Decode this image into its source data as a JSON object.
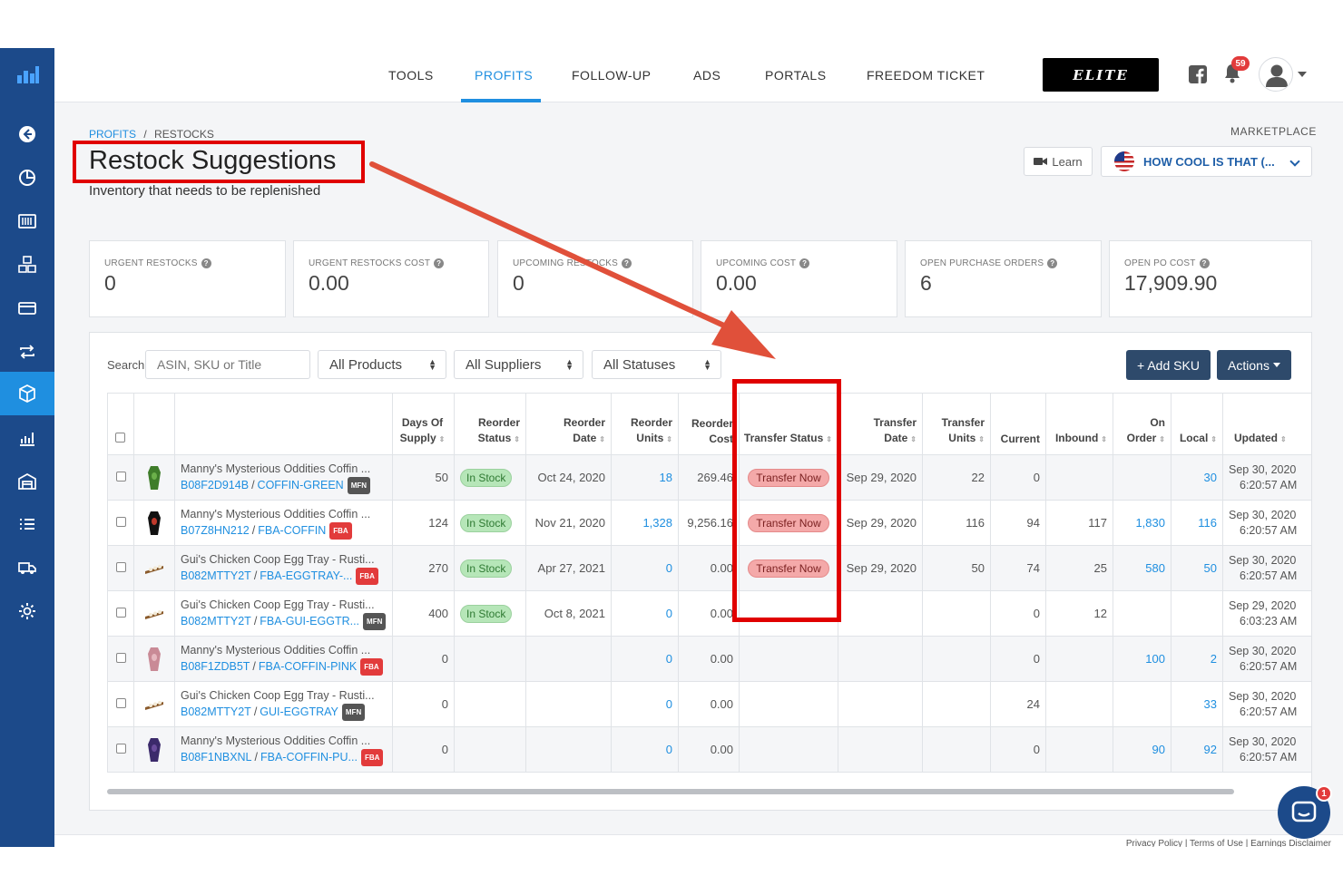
{
  "nav": {
    "items": [
      "TOOLS",
      "PROFITS",
      "FOLLOW-UP",
      "ADS",
      "PORTALS",
      "FREEDOM TICKET"
    ],
    "active": "PROFITS",
    "elite_label": "ELITE",
    "notifications": "59"
  },
  "sidebar": {
    "icons": [
      "back-arrow-icon",
      "pie-chart-icon",
      "barcode-icon",
      "boxes-icon",
      "credit-card-icon",
      "repeat-icon",
      "cube-icon",
      "bar-chart-icon",
      "warehouse-icon",
      "list-icon",
      "truck-icon",
      "settings-gear-icon"
    ],
    "active": "cube-icon"
  },
  "breadcrumb": {
    "root": "PROFITS",
    "separator": "/",
    "current": "RESTOCKS"
  },
  "page": {
    "title": "Restock Suggestions",
    "subtitle": "Inventory that needs to be replenished"
  },
  "marketplace": {
    "label": "MARKETPLACE",
    "learn": "Learn",
    "store": "HOW COOL IS THAT (..."
  },
  "cards": [
    {
      "label": "URGENT RESTOCKS",
      "value": "0"
    },
    {
      "label": "URGENT RESTOCKS COST",
      "value": "0.00"
    },
    {
      "label": "UPCOMING RESTOCKS",
      "value": "0"
    },
    {
      "label": "UPCOMING COST",
      "value": "0.00"
    },
    {
      "label": "OPEN PURCHASE ORDERS",
      "value": "6"
    },
    {
      "label": "OPEN PO COST",
      "value": "17,909.90"
    }
  ],
  "filters": {
    "search_label": "Search",
    "search_placeholder": "ASIN, SKU or Title",
    "products": "All Products",
    "suppliers": "All Suppliers",
    "statuses": "All Statuses",
    "add_sku": "+ Add SKU",
    "actions": "Actions"
  },
  "table": {
    "headers": {
      "days": "Days Of Supply",
      "reorder_status": "Reorder Status",
      "reorder_date": "Reorder Date",
      "reorder_units": "Reorder Units",
      "reorder_cost": "Reorder Cost",
      "transfer_status": "Transfer Status",
      "transfer_date": "Transfer Date",
      "transfer_units": "Transfer Units",
      "current": "Current",
      "inbound": "Inbound",
      "on_order": "On Order",
      "local": "Local",
      "updated": "Updated"
    },
    "rows": [
      {
        "thumb": "green",
        "name": "Manny's Mysterious Oddities Coffin ...",
        "asin": "B08F2D914B",
        "sku": "COFFIN-GREEN",
        "channel": "MFN",
        "days": "50",
        "reorder_status": "In Stock",
        "reorder_date": "Oct 24, 2020",
        "reorder_units": "18",
        "reorder_cost": "269.46",
        "transfer_status": "Transfer Now",
        "transfer_date": "Sep 29, 2020",
        "transfer_units": "22",
        "current": "0",
        "inbound": "",
        "on_order": "",
        "local": "30",
        "updated_date": "Sep 30, 2020",
        "updated_time": "6:20:57 AM"
      },
      {
        "thumb": "black",
        "name": "Manny's Mysterious Oddities Coffin ...",
        "asin": "B07Z8HN212",
        "sku": "FBA-COFFIN",
        "channel": "FBA",
        "days": "124",
        "reorder_status": "In Stock",
        "reorder_date": "Nov 21, 2020",
        "reorder_units": "1,328",
        "reorder_cost": "9,256.16",
        "transfer_status": "Transfer Now",
        "transfer_date": "Sep 29, 2020",
        "transfer_units": "116",
        "current": "94",
        "inbound": "117",
        "on_order": "1,830",
        "local": "116",
        "updated_date": "Sep 30, 2020",
        "updated_time": "6:20:57 AM"
      },
      {
        "thumb": "tray",
        "name": "Gui's Chicken Coop Egg Tray - Rusti...",
        "asin": "B082MTTY2T",
        "sku": "FBA-EGGTRAY-...",
        "channel": "FBA",
        "days": "270",
        "reorder_status": "In Stock",
        "reorder_date": "Apr 27, 2021",
        "reorder_units": "0",
        "reorder_cost": "0.00",
        "transfer_status": "Transfer Now",
        "transfer_date": "Sep 29, 2020",
        "transfer_units": "50",
        "current": "74",
        "inbound": "25",
        "on_order": "580",
        "local": "50",
        "updated_date": "Sep 30, 2020",
        "updated_time": "6:20:57 AM"
      },
      {
        "thumb": "tray",
        "name": "Gui's Chicken Coop Egg Tray - Rusti...",
        "asin": "B082MTTY2T",
        "sku": "FBA-GUI-EGGTR...",
        "channel": "MFN",
        "days": "400",
        "reorder_status": "In Stock",
        "reorder_date": "Oct 8, 2021",
        "reorder_units": "0",
        "reorder_cost": "0.00",
        "transfer_status": "",
        "transfer_date": "",
        "transfer_units": "",
        "current": "0",
        "inbound": "12",
        "on_order": "",
        "local": "",
        "updated_date": "Sep 29, 2020",
        "updated_time": "6:03:23 AM"
      },
      {
        "thumb": "pink",
        "name": "Manny's Mysterious Oddities Coffin ...",
        "asin": "B08F1ZDB5T",
        "sku": "FBA-COFFIN-PINK",
        "channel": "FBA",
        "days": "0",
        "reorder_status": "",
        "reorder_date": "",
        "reorder_units": "0",
        "reorder_cost": "0.00",
        "transfer_status": "",
        "transfer_date": "",
        "transfer_units": "",
        "current": "0",
        "inbound": "",
        "on_order": "100",
        "local": "2",
        "updated_date": "Sep 30, 2020",
        "updated_time": "6:20:57 AM"
      },
      {
        "thumb": "tray",
        "name": "Gui's Chicken Coop Egg Tray - Rusti...",
        "asin": "B082MTTY2T",
        "sku": "GUI-EGGTRAY",
        "channel": "MFN",
        "days": "0",
        "reorder_status": "",
        "reorder_date": "",
        "reorder_units": "0",
        "reorder_cost": "0.00",
        "transfer_status": "",
        "transfer_date": "",
        "transfer_units": "",
        "current": "24",
        "inbound": "",
        "on_order": "",
        "local": "33",
        "updated_date": "Sep 30, 2020",
        "updated_time": "6:20:57 AM"
      },
      {
        "thumb": "purple",
        "name": "Manny's Mysterious Oddities Coffin ...",
        "asin": "B08F1NBXNL",
        "sku": "FBA-COFFIN-PU...",
        "channel": "FBA",
        "days": "0",
        "reorder_status": "",
        "reorder_date": "",
        "reorder_units": "0",
        "reorder_cost": "0.00",
        "transfer_status": "",
        "transfer_date": "",
        "transfer_units": "",
        "current": "0",
        "inbound": "",
        "on_order": "90",
        "local": "92",
        "updated_date": "Sep 30, 2020",
        "updated_time": "6:20:57 AM"
      }
    ]
  },
  "footer": {
    "links": "Privacy Policy | Terms of Use | Earnings Disclaimer"
  },
  "chat": {
    "badge": "1"
  },
  "colors": {
    "sidebar": "#1c4a8a",
    "accent": "#1f8fe0",
    "annotation": "#e00000",
    "arrow": "#e0503a",
    "in_stock": "#b6e6b8",
    "transfer_now": "#f4a9a9"
  }
}
